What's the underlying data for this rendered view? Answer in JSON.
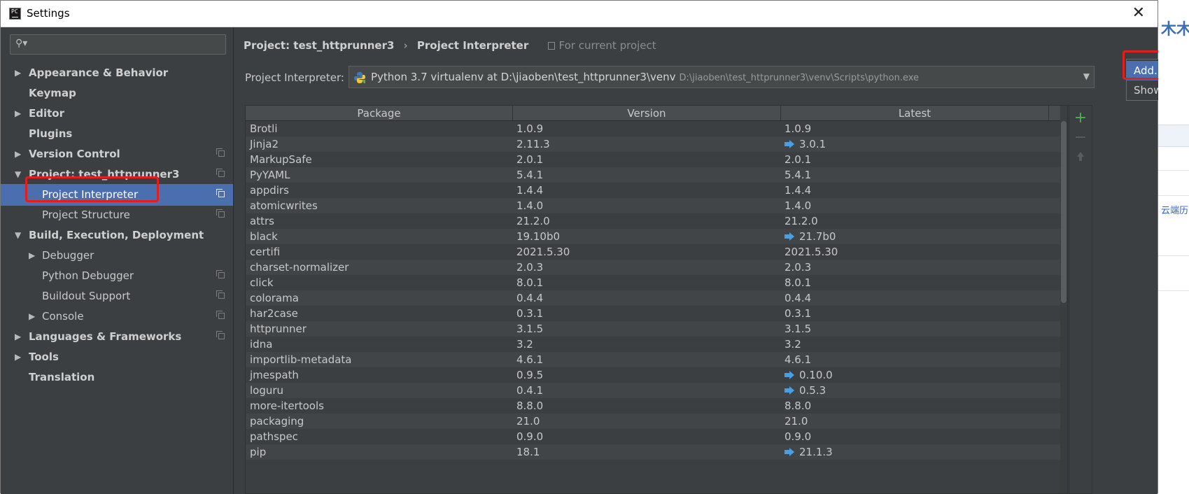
{
  "window": {
    "title": "Settings"
  },
  "search": {
    "placeholder": ""
  },
  "sidebar": {
    "items": [
      {
        "label": "Appearance & Behavior"
      },
      {
        "label": "Keymap"
      },
      {
        "label": "Editor"
      },
      {
        "label": "Plugins"
      },
      {
        "label": "Version Control"
      },
      {
        "label": "Project: test_httprunner3"
      },
      {
        "label": "Project Interpreter"
      },
      {
        "label": "Project Structure"
      },
      {
        "label": "Build, Execution, Deployment"
      },
      {
        "label": "Debugger"
      },
      {
        "label": "Python Debugger"
      },
      {
        "label": "Buildout Support"
      },
      {
        "label": "Console"
      },
      {
        "label": "Languages & Frameworks"
      },
      {
        "label": "Tools"
      },
      {
        "label": "Translation"
      }
    ]
  },
  "breadcrumb": {
    "project": "Project: test_httprunner3",
    "separator": "›",
    "page": "Project Interpreter",
    "scope": "For current project"
  },
  "interpreter": {
    "label": "Project Interpreter:",
    "name": "Python 3.7 virtualenv at D:\\jiaoben\\test_httprunner3\\venv",
    "path": "D:\\jiaoben\\test_httprunner3\\venv\\Scripts\\python.exe"
  },
  "popup": {
    "add": "Add...",
    "show_all": "Show All..."
  },
  "table": {
    "headers": [
      "Package",
      "Version",
      "Latest"
    ],
    "rows": [
      {
        "package": "Brotli",
        "version": "1.0.9",
        "latest": "1.0.9",
        "upgrade": false
      },
      {
        "package": "Jinja2",
        "version": "2.11.3",
        "latest": "3.0.1",
        "upgrade": true
      },
      {
        "package": "MarkupSafe",
        "version": "2.0.1",
        "latest": "2.0.1",
        "upgrade": false
      },
      {
        "package": "PyYAML",
        "version": "5.4.1",
        "latest": "5.4.1",
        "upgrade": false
      },
      {
        "package": "appdirs",
        "version": "1.4.4",
        "latest": "1.4.4",
        "upgrade": false
      },
      {
        "package": "atomicwrites",
        "version": "1.4.0",
        "latest": "1.4.0",
        "upgrade": false
      },
      {
        "package": "attrs",
        "version": "21.2.0",
        "latest": "21.2.0",
        "upgrade": false
      },
      {
        "package": "black",
        "version": "19.10b0",
        "latest": "21.7b0",
        "upgrade": true
      },
      {
        "package": "certifi",
        "version": "2021.5.30",
        "latest": "2021.5.30",
        "upgrade": false
      },
      {
        "package": "charset-normalizer",
        "version": "2.0.3",
        "latest": "2.0.3",
        "upgrade": false
      },
      {
        "package": "click",
        "version": "8.0.1",
        "latest": "8.0.1",
        "upgrade": false
      },
      {
        "package": "colorama",
        "version": "0.4.4",
        "latest": "0.4.4",
        "upgrade": false
      },
      {
        "package": "har2case",
        "version": "0.3.1",
        "latest": "0.3.1",
        "upgrade": false
      },
      {
        "package": "httprunner",
        "version": "3.1.5",
        "latest": "3.1.5",
        "upgrade": false
      },
      {
        "package": "idna",
        "version": "3.2",
        "latest": "3.2",
        "upgrade": false
      },
      {
        "package": "importlib-metadata",
        "version": "4.6.1",
        "latest": "4.6.1",
        "upgrade": false
      },
      {
        "package": "jmespath",
        "version": "0.9.5",
        "latest": "0.10.0",
        "upgrade": true
      },
      {
        "package": "loguru",
        "version": "0.4.1",
        "latest": "0.5.3",
        "upgrade": true
      },
      {
        "package": "more-itertools",
        "version": "8.8.0",
        "latest": "8.8.0",
        "upgrade": false
      },
      {
        "package": "packaging",
        "version": "21.0",
        "latest": "21.0",
        "upgrade": false
      },
      {
        "package": "pathspec",
        "version": "0.9.0",
        "latest": "0.9.0",
        "upgrade": false
      },
      {
        "package": "pip",
        "version": "18.1",
        "latest": "21.1.3",
        "upgrade": true
      }
    ]
  },
  "toolbar": {
    "add": "+",
    "remove": "−"
  },
  "background": {
    "text_top": "木木",
    "text_mid": "云端历"
  },
  "colors": {
    "accent": "#4b6eaf",
    "highlight": "#e21f1f",
    "upgrade_arrow": "#4a9fe0",
    "add": "#4fae4f"
  }
}
